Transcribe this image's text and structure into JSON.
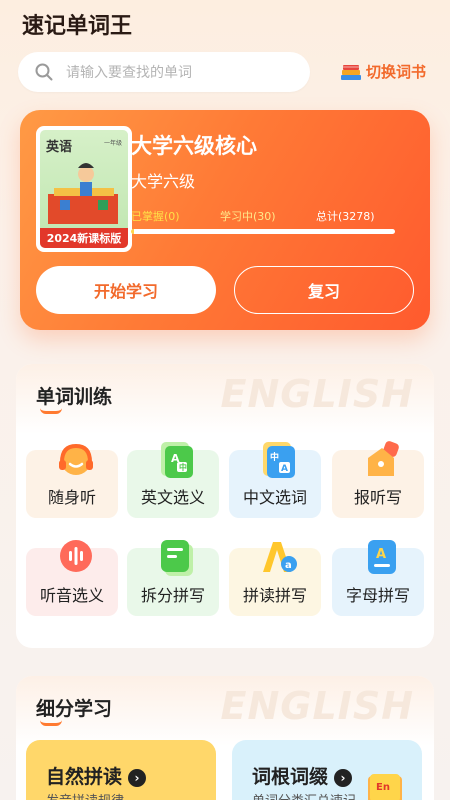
{
  "app": {
    "title": "速记单词王"
  },
  "search": {
    "placeholder": "请输入要查找的单词"
  },
  "switch_book": {
    "label": "切换词书",
    "icon": "books-icon"
  },
  "hero": {
    "cover": {
      "title": "英语",
      "tag": "一年级",
      "badge": "2024新课标版"
    },
    "book_title": "大学六级核心",
    "book_subtitle": "大学六级",
    "stats": {
      "mastered_label": "已掌握",
      "mastered": "(0)",
      "learning_label": "学习中",
      "learning": "(30)",
      "total_label": "总计",
      "total": "(3278)"
    },
    "progress": 0.01,
    "start_label": "开始学习",
    "review_label": "复习"
  },
  "training": {
    "title": "单词训练",
    "watermark": "ENGLISH",
    "items": [
      {
        "label": "随身听",
        "icon": "headphones-icon",
        "bg": "#fdf2e6"
      },
      {
        "label": "英文选义",
        "icon": "translate-en-icon",
        "bg": "#e9f8e9"
      },
      {
        "label": "中文选词",
        "icon": "translate-zh-icon",
        "bg": "#e6f3fc"
      },
      {
        "label": "报听写",
        "icon": "dictation-icon",
        "bg": "#fdf2e6"
      },
      {
        "label": "听音选义",
        "icon": "voice-icon",
        "bg": "#fdeceb"
      },
      {
        "label": "拆分拼写",
        "icon": "split-spell-icon",
        "bg": "#e9f8e9"
      },
      {
        "label": "拼读拼写",
        "icon": "phonics-icon",
        "bg": "#fdf6e2"
      },
      {
        "label": "字母拼写",
        "icon": "letter-icon",
        "bg": "#e6f3fc"
      }
    ]
  },
  "detail": {
    "title": "细分学习",
    "watermark": "ENGLISH",
    "cards": [
      {
        "title": "自然拼读",
        "desc": "发音拼读规律",
        "bg": "#ffd76a"
      },
      {
        "title": "词根词缀",
        "desc": "单词分类汇总速记",
        "bg": "#d9f1fb"
      }
    ]
  },
  "colors": {
    "accent": "#ff7a36",
    "brand": "#f26a2c"
  }
}
